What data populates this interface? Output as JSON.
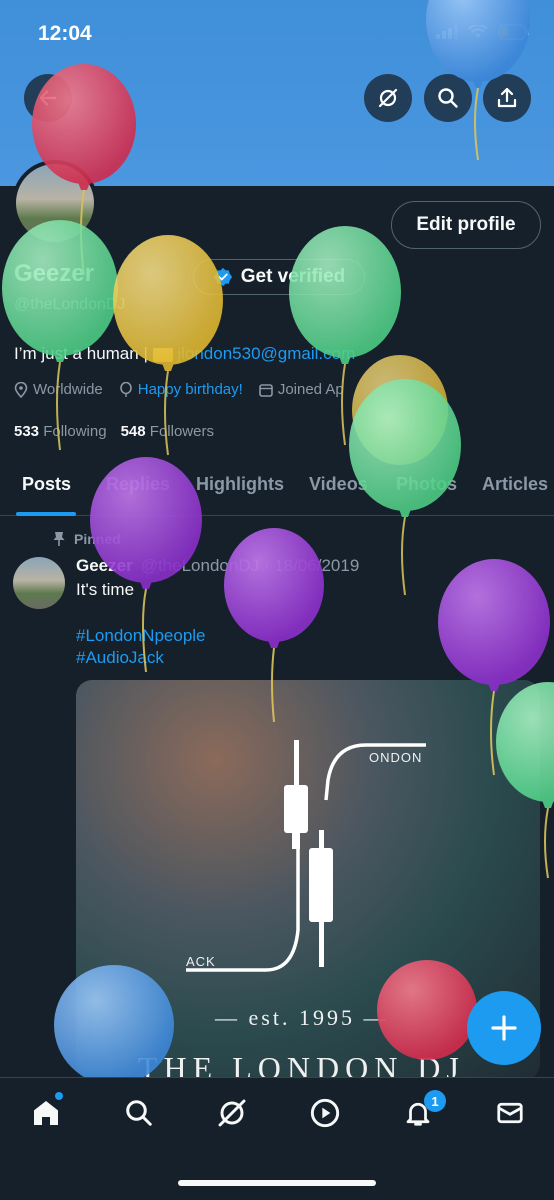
{
  "status_bar": {
    "time": "12:04"
  },
  "header": {
    "back_icon": "arrow-left-icon",
    "grok_icon": "grok-icon",
    "search_icon": "search-icon",
    "share_icon": "share-icon"
  },
  "profile": {
    "edit_label": "Edit profile",
    "name": "Geezer",
    "get_verified_label": "Get verified",
    "handle": "@theLondonDJ",
    "bio_text": "I’m just a human",
    "bio_email": "jlondon530@gmail.com",
    "location": "Worldwide",
    "birthday": "Happy birthday!",
    "joined": "Joined Ap",
    "following_count": "533",
    "following_label": "Following",
    "followers_count": "548",
    "followers_label": "Followers"
  },
  "tabs": [
    {
      "label": "Posts"
    },
    {
      "label": "Replies"
    },
    {
      "label": "Highlights"
    },
    {
      "label": "Videos"
    },
    {
      "label": "Photos"
    },
    {
      "label": "Articles"
    }
  ],
  "post": {
    "pinned_label": "Pinned",
    "author": "Geezer",
    "handle_date": "@theLondonDJ · 18/06/2019",
    "text": "It's time",
    "hashtag1": "#LondonNpeople",
    "hashtag2": "#AudioJack",
    "media": {
      "label_right": "ONDON",
      "label_left": "ACK",
      "est": "— est. 1995 —",
      "title": "THE LONDON DJ"
    }
  },
  "fab": {
    "icon": "plus-icon"
  },
  "bottom_nav": {
    "items": [
      "home-icon",
      "search-icon",
      "grok-icon",
      "play-icon",
      "bell-icon",
      "mail-icon"
    ],
    "notification_count": "1"
  },
  "colors": {
    "accent": "#1d9bf0",
    "background": "#15202b",
    "banner": "#4b97e0"
  }
}
